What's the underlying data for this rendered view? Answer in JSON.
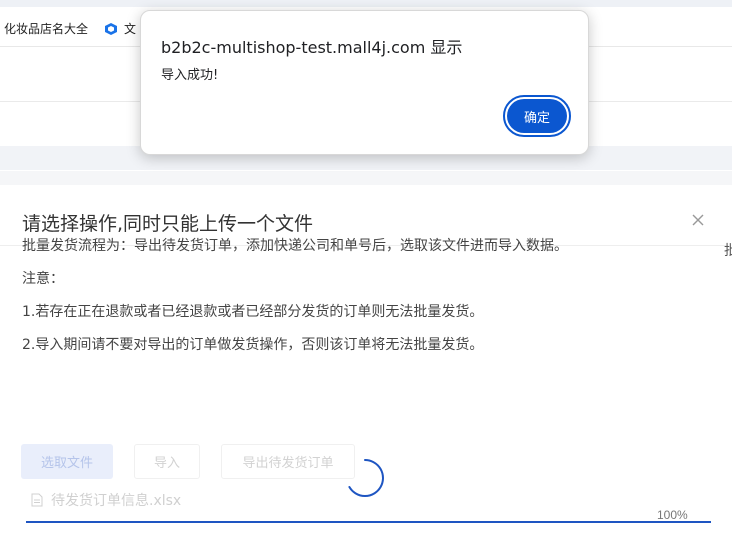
{
  "browser": {
    "bookmarks": [
      {
        "label": "化妆品店名大全",
        "icon": "none"
      },
      {
        "label": "文",
        "icon": "cube-icon"
      }
    ]
  },
  "alert": {
    "title": "b2b2c-multishop-test.mall4j.com 显示",
    "message": "导入成功!",
    "ok_label": "确定",
    "accent_color": "#0b57d0"
  },
  "modal": {
    "title": "请选择操作,同时只能上传一个文件",
    "paragraphs": [
      "批量发货流程为：导出待发货订单，添加快递公司和单号后，选取该文件进而导入数据。",
      "注意：",
      "1.若存在正在退款或者已经退款或者已经部分发货的订单则无法批量发货。",
      "2.导入期间请不要对导出的订单做发货操作，否则该订单将无法批量发货。"
    ],
    "buttons": {
      "select_file": "选取文件",
      "import": "导入",
      "export_pending": "导出待发货订单"
    },
    "file_name": "待发货订单信息.xlsx",
    "progress": {
      "percent": 100,
      "label": "100%",
      "color": "#1e55c2"
    },
    "edge_char": "批"
  }
}
